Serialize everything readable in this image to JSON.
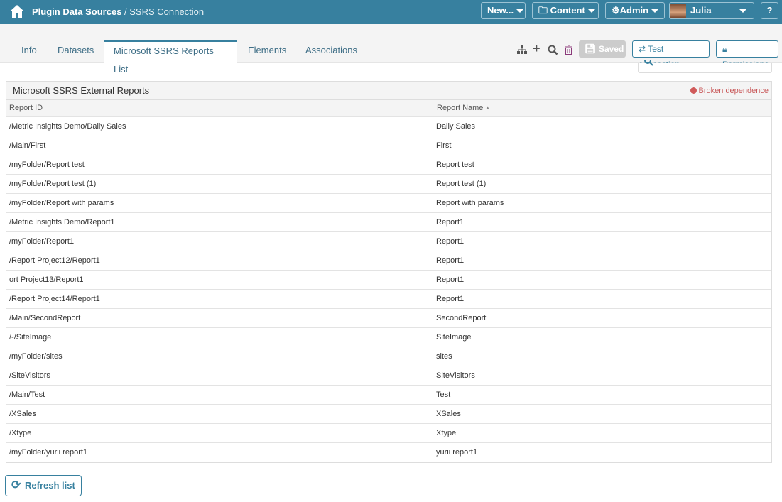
{
  "header": {
    "breadcrumb_parent": "Plugin Data Sources",
    "breadcrumb_sep": " / ",
    "breadcrumb_current": "SSRS Connection",
    "new_label": "New...",
    "content_label": "Content",
    "admin_label": "Admin",
    "user_name": "Julia",
    "help_label": "?"
  },
  "tabs": [
    {
      "label": "Info"
    },
    {
      "label": "Datasets"
    },
    {
      "label": "Microsoft SSRS Reports List"
    },
    {
      "label": "Elements"
    },
    {
      "label": "Associations"
    }
  ],
  "toolbar": {
    "saved_label": "Saved",
    "test_label": "Test connection",
    "permissions_label": "Permissions"
  },
  "panel": {
    "title": "Microsoft SSRS External Reports",
    "status": "Broken dependence",
    "columns": [
      "Report ID",
      "Report Name"
    ],
    "sort_indicator": "▲",
    "rows": [
      [
        "/Metric Insights Demo/Daily Sales",
        "Daily Sales"
      ],
      [
        "/Main/First",
        "First"
      ],
      [
        "/myFolder/Report test",
        "Report test"
      ],
      [
        "/myFolder/Report test (1)",
        "Report test (1)"
      ],
      [
        "/myFolder/Report with params",
        "Report with params"
      ],
      [
        "/Metric Insights Demo/Report1",
        "Report1"
      ],
      [
        "/myFolder/Report1",
        "Report1"
      ],
      [
        "/Report Project12/Report1",
        "Report1"
      ],
      [
        "ort Project13/Report1",
        "Report1"
      ],
      [
        "/Report Project14/Report1",
        "Report1"
      ],
      [
        "/Main/SecondReport",
        "SecondReport"
      ],
      [
        "/-/SiteImage",
        "SiteImage"
      ],
      [
        "/myFolder/sites",
        "sites"
      ],
      [
        "/SiteVisitors",
        "SiteVisitors"
      ],
      [
        "/Main/Test",
        "Test"
      ],
      [
        "/XSales",
        "XSales"
      ],
      [
        "/Xtype",
        "Xtype"
      ],
      [
        "/myFolder/yurii report1",
        "yurii report1"
      ]
    ]
  },
  "refresh_label": "Refresh list"
}
